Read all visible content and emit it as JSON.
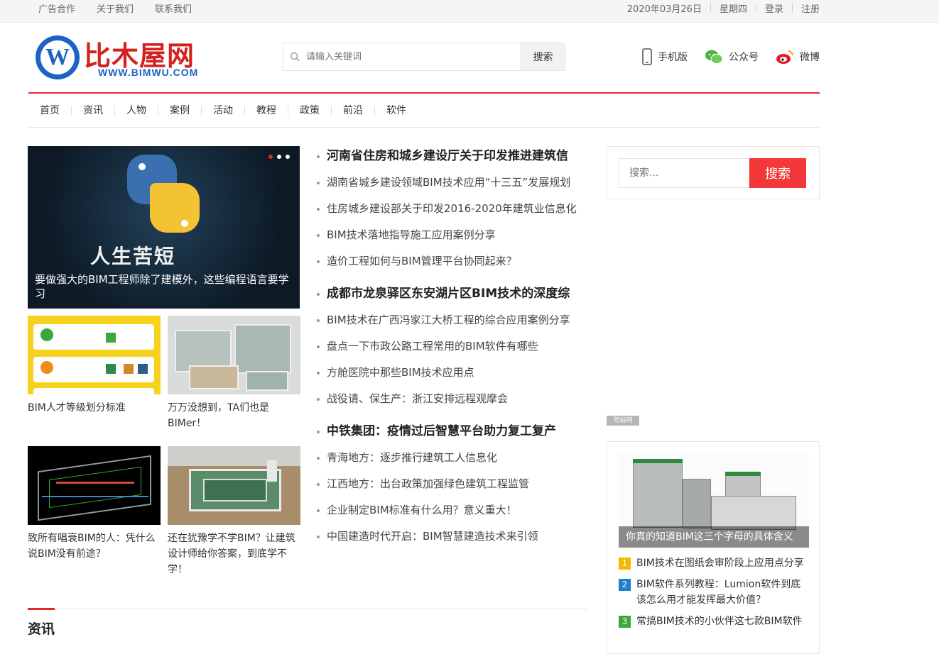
{
  "topbar": {
    "links": [
      "广告合作",
      "关于我们",
      "联系我们"
    ],
    "date": "2020年03月26日",
    "weekday": "星期四",
    "login": "登录",
    "register": "注册"
  },
  "logo": {
    "name": "比木屋网",
    "url": "WWW.BIMWU.COM",
    "letter": "W"
  },
  "search": {
    "placeholder": "请输入关键词",
    "button": "搜索"
  },
  "header_links": {
    "mobile": "手机版",
    "wechat": "公众号",
    "weibo": "微博"
  },
  "nav": [
    "首页",
    "资讯",
    "人物",
    "案例",
    "活动",
    "教程",
    "政策",
    "前沿",
    "软件"
  ],
  "slider": {
    "caption": "要做强大的BIM工程师除了建模外，这些编程语言要学习",
    "calligraphy": "人生苦短"
  },
  "thumbs": [
    {
      "title": "BIM人才等级划分标准"
    },
    {
      "title": "万万没想到，TA们也是BIMer！"
    },
    {
      "title": "致所有唱衰BIM的人：凭什么说BIM没有前途？"
    },
    {
      "title": "还在犹豫学不学BIM？让建筑设计师给你答案，到底学不学！"
    }
  ],
  "news_groups": [
    {
      "head": "河南省住房和城乡建设厅关于印发推进建筑信",
      "items": [
        "湖南省城乡建设领域BIM技术应用“十三五”发展规划",
        "住房城乡建设部关于印发2016-2020年建筑业信息化",
        "BIM技术落地指导施工应用案例分享",
        "造价工程如何与BIM管理平台协同起来？"
      ]
    },
    {
      "head": "成都市龙泉驿区东安湖片区BIM技术的深度综",
      "items": [
        "BIM技术在广西冯家江大桥工程的综合应用案例分享",
        "盘点一下市政公路工程常用的BIM软件有哪些",
        "方舱医院中那些BIM技术应用点",
        "战役请、保生产：浙江安排远程观摩会"
      ]
    },
    {
      "head": "中铁集团：疫情过后智慧平台助力复工复产",
      "items": [
        "青海地方：逐步推行建筑工人信息化",
        "江西地方：出台政策加强绿色建筑工程监管",
        "企业制定BIM标准有什么用？意义重大！",
        "中国建造时代开启：BIM智慧建造技术来引领"
      ]
    }
  ],
  "side_search": {
    "placeholder": "搜索...",
    "button": "搜索"
  },
  "ad_tag": "勿谷网",
  "hot": {
    "caption": "你真的知道BIM这三个字母的具体含义",
    "items": [
      {
        "num": "1",
        "color": "#f5b800",
        "text": "BIM技术在图纸会审阶段上应用点分享"
      },
      {
        "num": "2",
        "color": "#1e7fd1",
        "text": "BIM软件系列教程：Lumion软件到底该怎么用才能发挥最大价值？"
      },
      {
        "num": "3",
        "color": "#3aa83a",
        "text": "常搞BIM技术的小伙伴这七款BIM软件"
      }
    ]
  },
  "section_title": "资讯",
  "colors": {
    "accent_red": "#e02b2b",
    "logo_blue": "#1e62c5",
    "search_red": "#f23838"
  }
}
